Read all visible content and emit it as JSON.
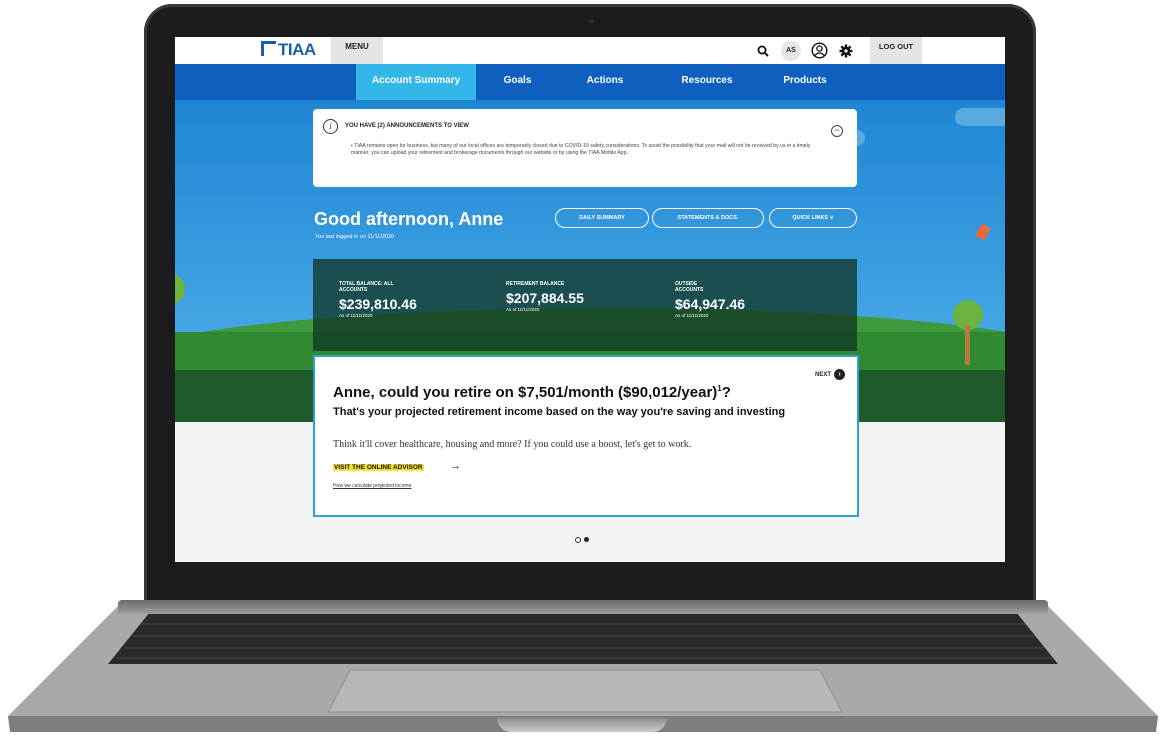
{
  "topbar": {
    "logo": "TIAA",
    "menu_label": "MENU",
    "avatar_initials": "AS",
    "logout_label": "LOG OUT",
    "icons": [
      "search-icon",
      "user-icon",
      "gear-icon"
    ]
  },
  "nav": {
    "items": [
      "Account Summary",
      "Goals",
      "Actions",
      "Resources",
      "Products"
    ],
    "active": "Account Summary",
    "active_color": "#33b6e8",
    "bar_color": "#0f5fbe"
  },
  "announcement": {
    "title": "YOU HAVE (2) ANNOUNCEMENTS TO VIEW",
    "body": "TIAA remains open for business, but many of our local offices are temporarily closed due to COVID-19 safety considerations. To avoid the possibility that your mail will not be received by us in a timely manner, you can upload your retirement and brokerage documents through our website or by using the TIAA Mobile App."
  },
  "greeting": {
    "title": "Good afternoon, Anne",
    "last_login": "You last logged in on 11/11/2020"
  },
  "quick_buttons": [
    "DAILY SUMMARY",
    "STATEMENTS & DOCS.",
    "QUICK LINKS"
  ],
  "balances": [
    {
      "label": "TOTAL BALANCE: ALL ACCOUNTS",
      "amount": "$239,810.46",
      "as_of": "As of 11/11/2020"
    },
    {
      "label": "RETIREMENT BALANCE",
      "amount": "$207,884.55",
      "as_of": "As of 11/11/2020"
    },
    {
      "label": "OUTSIDE ACCOUNTS",
      "amount": "$64,947.46",
      "as_of": "As of 11/11/2020"
    }
  ],
  "projection": {
    "next_label": "NEXT",
    "headline": "Anne, could you retire on $7,501/month ($90,012/year)",
    "footnote_mark": "1",
    "headline_end": "?",
    "subhead": "That's your projected retirement income based on the way you're saving and investing",
    "body": "Think it'll cover healthcare, housing and more? If you could use a boost, let's get to work.",
    "cta": "VISIT THE ONLINE ADVISOR",
    "cta_highlight": "#f4e23a",
    "link": "How we calculate projected income"
  },
  "carousel": {
    "count": 2,
    "active_index": 1
  }
}
